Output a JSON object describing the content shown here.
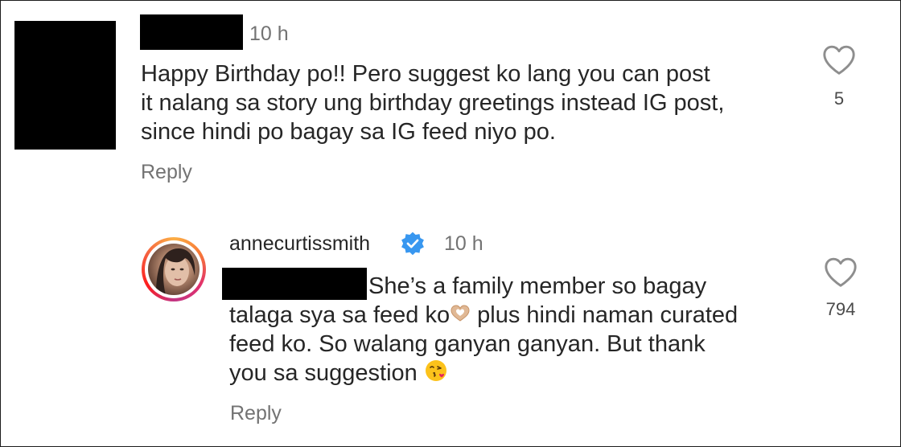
{
  "comment": {
    "timestamp": "10 h",
    "lines": [
      "Happy Birthday po!! Pero suggest ko lang you can post",
      "it nalang sa story ung birthday greetings instead IG post,",
      "since hindi po bagay sa IG feed niyo po."
    ],
    "reply_label": "Reply",
    "like_count": "5"
  },
  "reply": {
    "username": "annecurtissmith",
    "timestamp": "10 h",
    "line1": "She’s a family member so bagay",
    "line2a": "talaga sya sa feed ko",
    "line2b": " plus hindi naman curated",
    "line3": "feed ko. So walang ganyan ganyan. But thank",
    "line4": "you sa suggestion",
    "reply_label": "Reply",
    "like_count": "794"
  },
  "icons": {
    "verified": "verified-badge-icon",
    "like": "heart-outline-icon",
    "heart_hands": "heart-hands-emoji",
    "kiss": "face-blowing-kiss-emoji"
  },
  "colors": {
    "verified": "#3897f0",
    "muted": "#737373",
    "text": "#262626"
  }
}
